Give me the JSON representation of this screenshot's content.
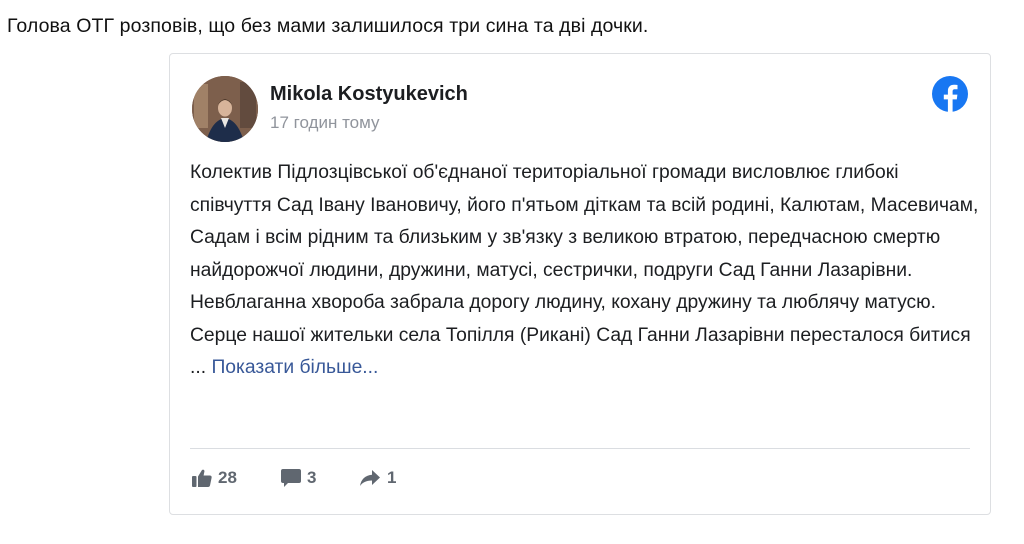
{
  "lead": "Голова ОТГ розповів, що без мами залишилося три сина та дві дочки.",
  "post": {
    "author": "Mikola Kostyukevich",
    "time": "17 годин тому",
    "text": "Колектив Підлозцівської об'єднаної територіальної громади висловлює глибокі співчуття Сад Івану Івановичу, його п'ятьом діткам та всій родині, Калютам, Масевичам, Садам і всім рідним та близьким у зв'язку з великою втратою, передчасною смертю найдорожчої людини, дружини, матусі, сестрички, подруги Сад Ганни Лазарівни. Невблаганна хвороба забрала дорогу людину, кохану дружину та люблячу матусю. Серце нашої жительки села Топілля (Рикані) Сад Ганни Лазарівни перестало­ся битися ... ",
    "more_link": "Показати більше...",
    "likes": "28",
    "comments": "3",
    "shares": "1"
  },
  "icons": {
    "brand": "facebook-icon",
    "like": "thumbs-up-icon",
    "comment": "comment-icon",
    "share": "share-arrow-icon"
  },
  "colors": {
    "facebook_blue": "#1877f2",
    "link": "#385898",
    "muted": "#90949c"
  }
}
